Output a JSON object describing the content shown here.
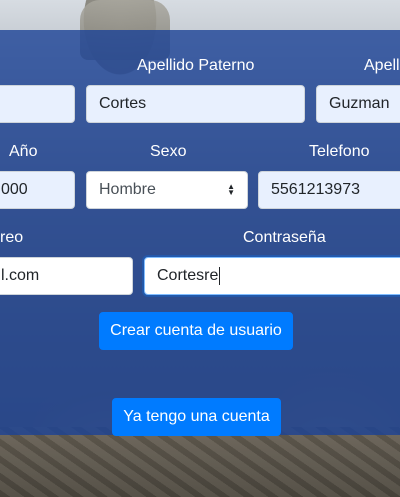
{
  "form": {
    "labels": {
      "apellido_paterno": "Apellido Paterno",
      "apellido_materno": "Apell",
      "anio": "Año",
      "sexo": "Sexo",
      "telefono": "Telefono",
      "correo": "reo",
      "contrasena": "Contraseña"
    },
    "values": {
      "apellido_paterno": "Cortes",
      "apellido_materno": "Guzman",
      "anio": "000",
      "sexo": "Hombre",
      "telefono": "5561213973",
      "correo": "l.com",
      "contrasena": "Cortesre"
    },
    "buttons": {
      "crear": "Crear cuenta de usuario",
      "ya_tengo": "Ya tengo una cuenta"
    }
  },
  "colors": {
    "overlay": "#1c4296",
    "primary": "#007bff",
    "autofill": "#e8f0fe"
  }
}
